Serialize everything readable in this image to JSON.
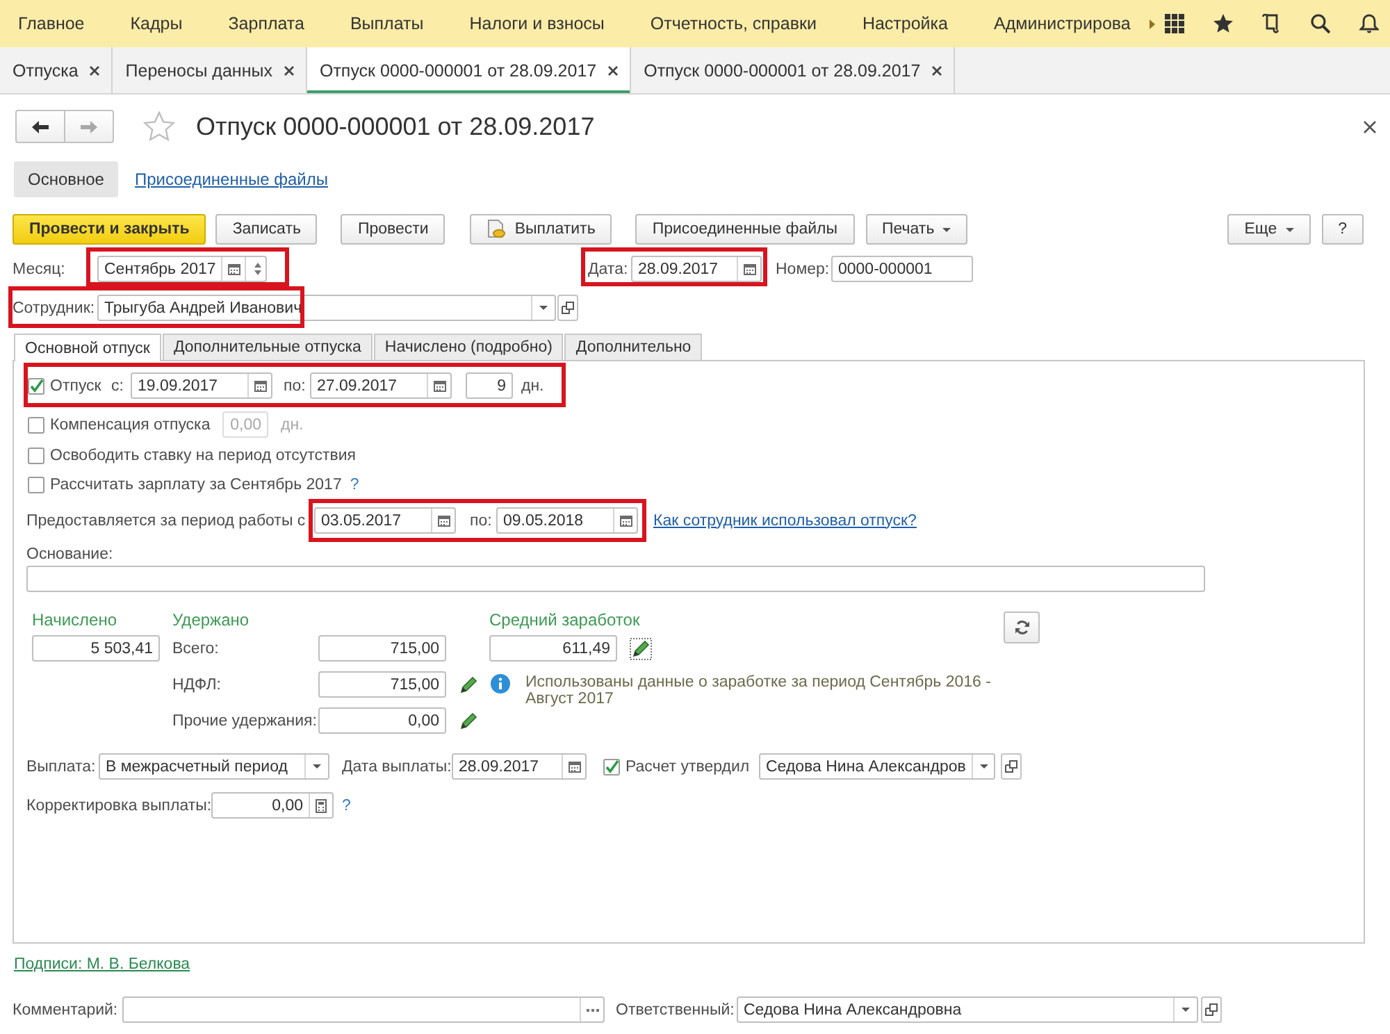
{
  "main_menu": [
    "Главное",
    "Кадры",
    "Зарплата",
    "Выплаты",
    "Налоги и взносы",
    "Отчетность, справки",
    "Настройка",
    "Администрирова"
  ],
  "open_tabs": [
    {
      "label": "Отпуска",
      "selected": false
    },
    {
      "label": "Переносы данных",
      "selected": false
    },
    {
      "label": "Отпуск 0000-000001 от 28.09.2017",
      "selected": true
    },
    {
      "label": "Отпуск 0000-000001 от 28.09.2017",
      "selected": false
    }
  ],
  "document": {
    "title": "Отпуск 0000-000001 от 28.09.2017",
    "sections": [
      {
        "label": "Основное",
        "selected": true
      },
      {
        "label": "Присоединенные файлы",
        "selected": false
      }
    ]
  },
  "command_bar": {
    "buttons": [
      {
        "label": "Провести и закрыть",
        "kind": "primary"
      },
      {
        "label": "Записать",
        "kind": "plain"
      },
      {
        "label": "Провести",
        "kind": "plain"
      },
      {
        "label": "Выплатить",
        "kind": "pay"
      },
      {
        "label": "Присоединенные файлы",
        "kind": "plain"
      },
      {
        "label": "Печать",
        "kind": "menu"
      }
    ],
    "right_buttons": [
      {
        "label": "Еще",
        "kind": "menu"
      },
      {
        "label": "?",
        "kind": "plain"
      }
    ]
  },
  "header_fields": {
    "month": {
      "label": "Месяц:",
      "value": "Сентябрь 2017",
      "highlighted": true
    },
    "date": {
      "label": "Дата:",
      "value": "28.09.2017",
      "highlighted": true
    },
    "number": {
      "label": "Номер:",
      "value": "0000-000001"
    },
    "employee": {
      "label": "Сотрудник:",
      "value": "Трыгуба Андрей Иванович",
      "highlighted": true
    }
  },
  "form_tabs": [
    {
      "label": "Основной отпуск",
      "selected": true
    },
    {
      "label": "Дополнительные отпуска",
      "selected": false
    },
    {
      "label": "Начислено (подробно)",
      "selected": false
    },
    {
      "label": "Дополнительно",
      "selected": false
    }
  ],
  "main_vacation_tab": {
    "vacation": {
      "checked": true,
      "label": "Отпуск",
      "from_label": "с:",
      "from": "19.09.2017",
      "to_label": "по:",
      "to": "27.09.2017",
      "days": "9",
      "days_unit": "дн.",
      "highlighted": true
    },
    "options": [
      {
        "kind": "compensation",
        "checked": false,
        "label": "Компенсация отпуска",
        "value": "0,00",
        "unit": "дн.",
        "disabled": true
      },
      {
        "kind": "plain",
        "checked": false,
        "label": "Освободить ставку на период отсутствия"
      },
      {
        "kind": "help",
        "checked": false,
        "label": "Рассчитать зарплату за Сентябрь 2017",
        "help": "?"
      }
    ],
    "work_period": {
      "label": "Предоставляется за период работы с",
      "from": "03.05.2017",
      "to_label": "по:",
      "to": "09.05.2018",
      "link": "Как сотрудник использовал отпуск?",
      "highlighted": true
    },
    "basis": {
      "label": "Основание:"
    },
    "accrued": {
      "heading": "Начислено",
      "value": "5 503,41"
    },
    "withheld": {
      "heading": "Удержано",
      "rows": [
        {
          "label": "Всего:",
          "value": "715,00",
          "editable": false
        },
        {
          "label": "НДФЛ:",
          "value": "715,00",
          "editable": true
        },
        {
          "label": "Прочие удержания:",
          "value": "0,00",
          "editable": true
        }
      ]
    },
    "average_earnings": {
      "heading": "Средний заработок",
      "value": "611,49",
      "note": "Использованы данные о заработке за период Сентябрь 2016 - Август 2017"
    },
    "payment": {
      "label": "Выплата:",
      "method": "В межрасчетный период",
      "date_label": "Дата выплаты:",
      "date": "28.09.2017",
      "approved": true,
      "approved_label": "Расчет утвердил",
      "approver": "Седова Нина Александров"
    },
    "correction": {
      "label": "Корректировка выплаты:",
      "value": "0,00",
      "help": "?"
    }
  },
  "signatures_link": "Подписи: М. В. Белкова",
  "footer": {
    "comment_label": "Комментарий:",
    "responsible_label": "Ответственный:",
    "responsible": "Седова Нина Александровна"
  }
}
